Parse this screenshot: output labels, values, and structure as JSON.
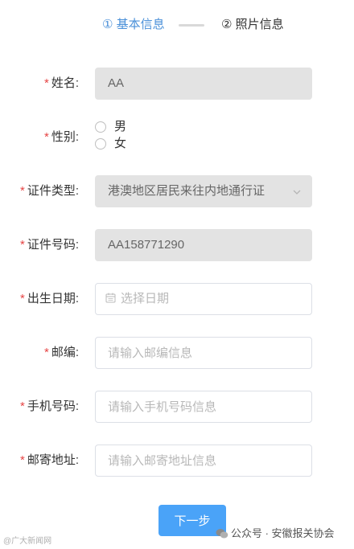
{
  "steps": [
    {
      "label": "① 基本信息",
      "active": true
    },
    {
      "label": "② 照片信息",
      "active": false
    }
  ],
  "colors": {
    "accent": "#4a90d9",
    "button": "#4aa3f8",
    "required": "#e64545",
    "disabled_bg": "#e3e3e3"
  },
  "required_mark": "*",
  "form": {
    "name": {
      "label": "姓名:",
      "value": "AA"
    },
    "gender": {
      "label": "性别:",
      "options": [
        "男",
        "女"
      ]
    },
    "id_type": {
      "label": "证件类型:",
      "value": "港澳地区居民来往内地通行证",
      "icon": "chevron-down-icon"
    },
    "id_number": {
      "label": "证件号码:",
      "value": "AA158771290"
    },
    "birth_date": {
      "label": "出生日期:",
      "placeholder": "选择日期",
      "icon": "calendar-icon"
    },
    "postcode": {
      "label": "邮编:",
      "placeholder": "请输入邮编信息"
    },
    "phone": {
      "label": "手机号码:",
      "placeholder": "请输入手机号码信息"
    },
    "address": {
      "label": "邮寄地址:",
      "placeholder": "请输入邮寄地址信息"
    }
  },
  "next_button": "下一步",
  "watermark_left": "@广大新闻网",
  "watermark_right": "公众号 · 安徽报关协会"
}
